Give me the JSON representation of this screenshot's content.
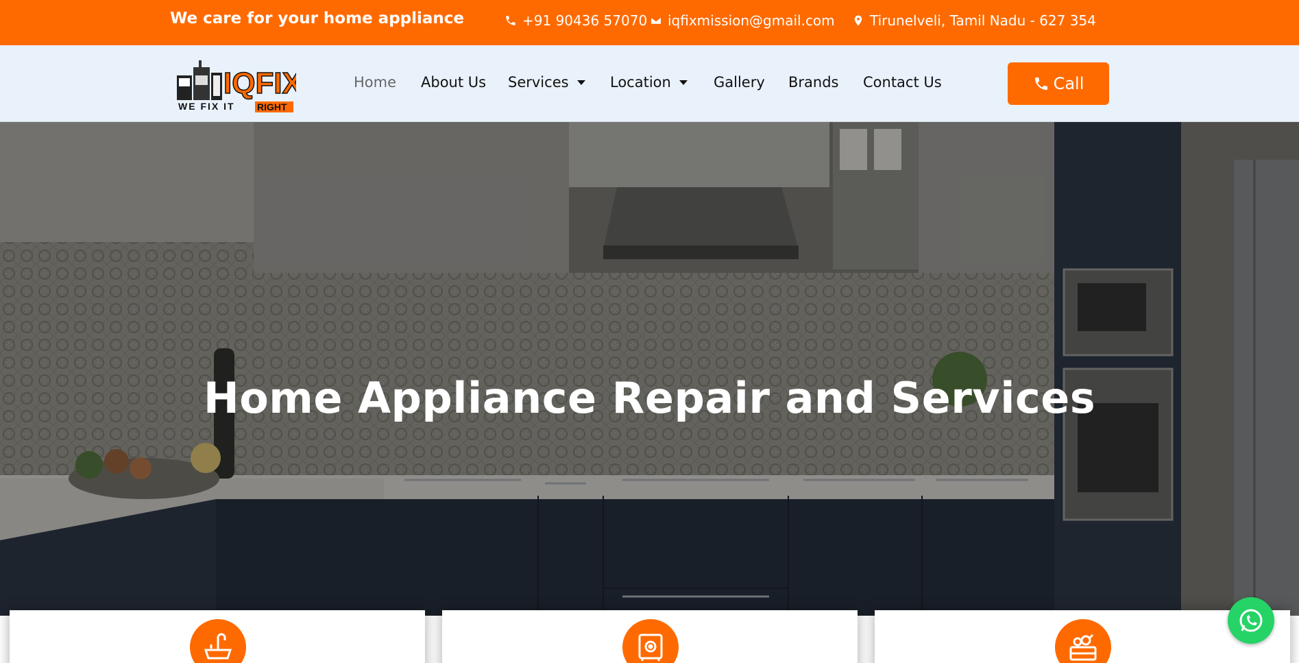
{
  "topbar": {
    "tagline": "We care for your home appliance",
    "phone": "+91 90436 57070",
    "email": "iqfixmission@gmail.com",
    "location": "Tirunelveli, Tamil Nadu - 627 354"
  },
  "brand": {
    "name": "IQFIX",
    "tagline_left": "WE FIX IT",
    "tagline_right": "RIGHT"
  },
  "nav": {
    "items": [
      {
        "label": "Home"
      },
      {
        "label": "About Us"
      },
      {
        "label": "Services"
      },
      {
        "label": "Location"
      },
      {
        "label": "Gallery"
      },
      {
        "label": "Brands"
      },
      {
        "label": "Contact Us"
      }
    ],
    "call_label": "Call"
  },
  "hero": {
    "title": "Home Appliance Repair and Services"
  },
  "cards": [
    {
      "icon": "sink-icon"
    },
    {
      "icon": "safe-icon"
    },
    {
      "icon": "vegetable-basket-icon"
    }
  ],
  "colors": {
    "accent": "#ff6a00",
    "nav_bg": "#e9f2fb",
    "whatsapp": "#25d366"
  }
}
